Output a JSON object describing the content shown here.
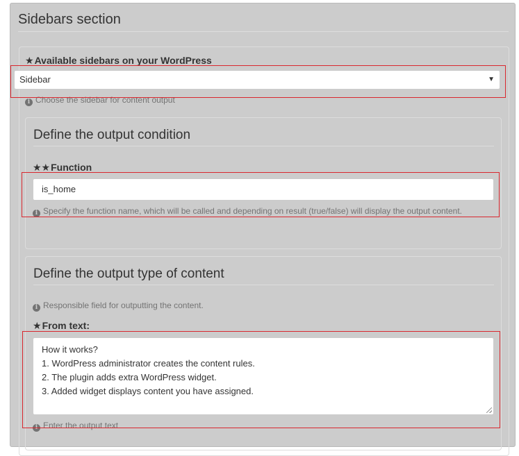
{
  "section": {
    "title": "Sidebars section"
  },
  "sidebars_field": {
    "star": "★",
    "label": "Available sidebars on your WordPress",
    "selected_value": "Sidebar",
    "help": "Choose the sidebar for content output"
  },
  "condition": {
    "title": "Define the output condition",
    "function_field": {
      "star": "★★",
      "label": "Function",
      "value": "is_home",
      "help": "Specify the function name, which will be called and depending on result (true/false) will display the output content."
    }
  },
  "content_type": {
    "title": "Define the output type of content",
    "help": "Responsible field for outputting the content.",
    "from_text_field": {
      "star": "★",
      "label": "From text:",
      "lines": [
        "How it works?",
        "1. WordPress administrator creates the content rules.",
        "2. The plugin adds extra WordPress widget.",
        "3. Added widget displays content you have assigned."
      ],
      "help": "Enter the output text"
    }
  },
  "icons": {
    "info": "info-circle-icon",
    "dropdown": "caret-down-icon",
    "resize": "resize-grip-icon"
  },
  "colors": {
    "panel_background": "#cccccc",
    "highlight_border": "#d9272e",
    "input_background": "#ffffff",
    "help_text": "#737373"
  }
}
